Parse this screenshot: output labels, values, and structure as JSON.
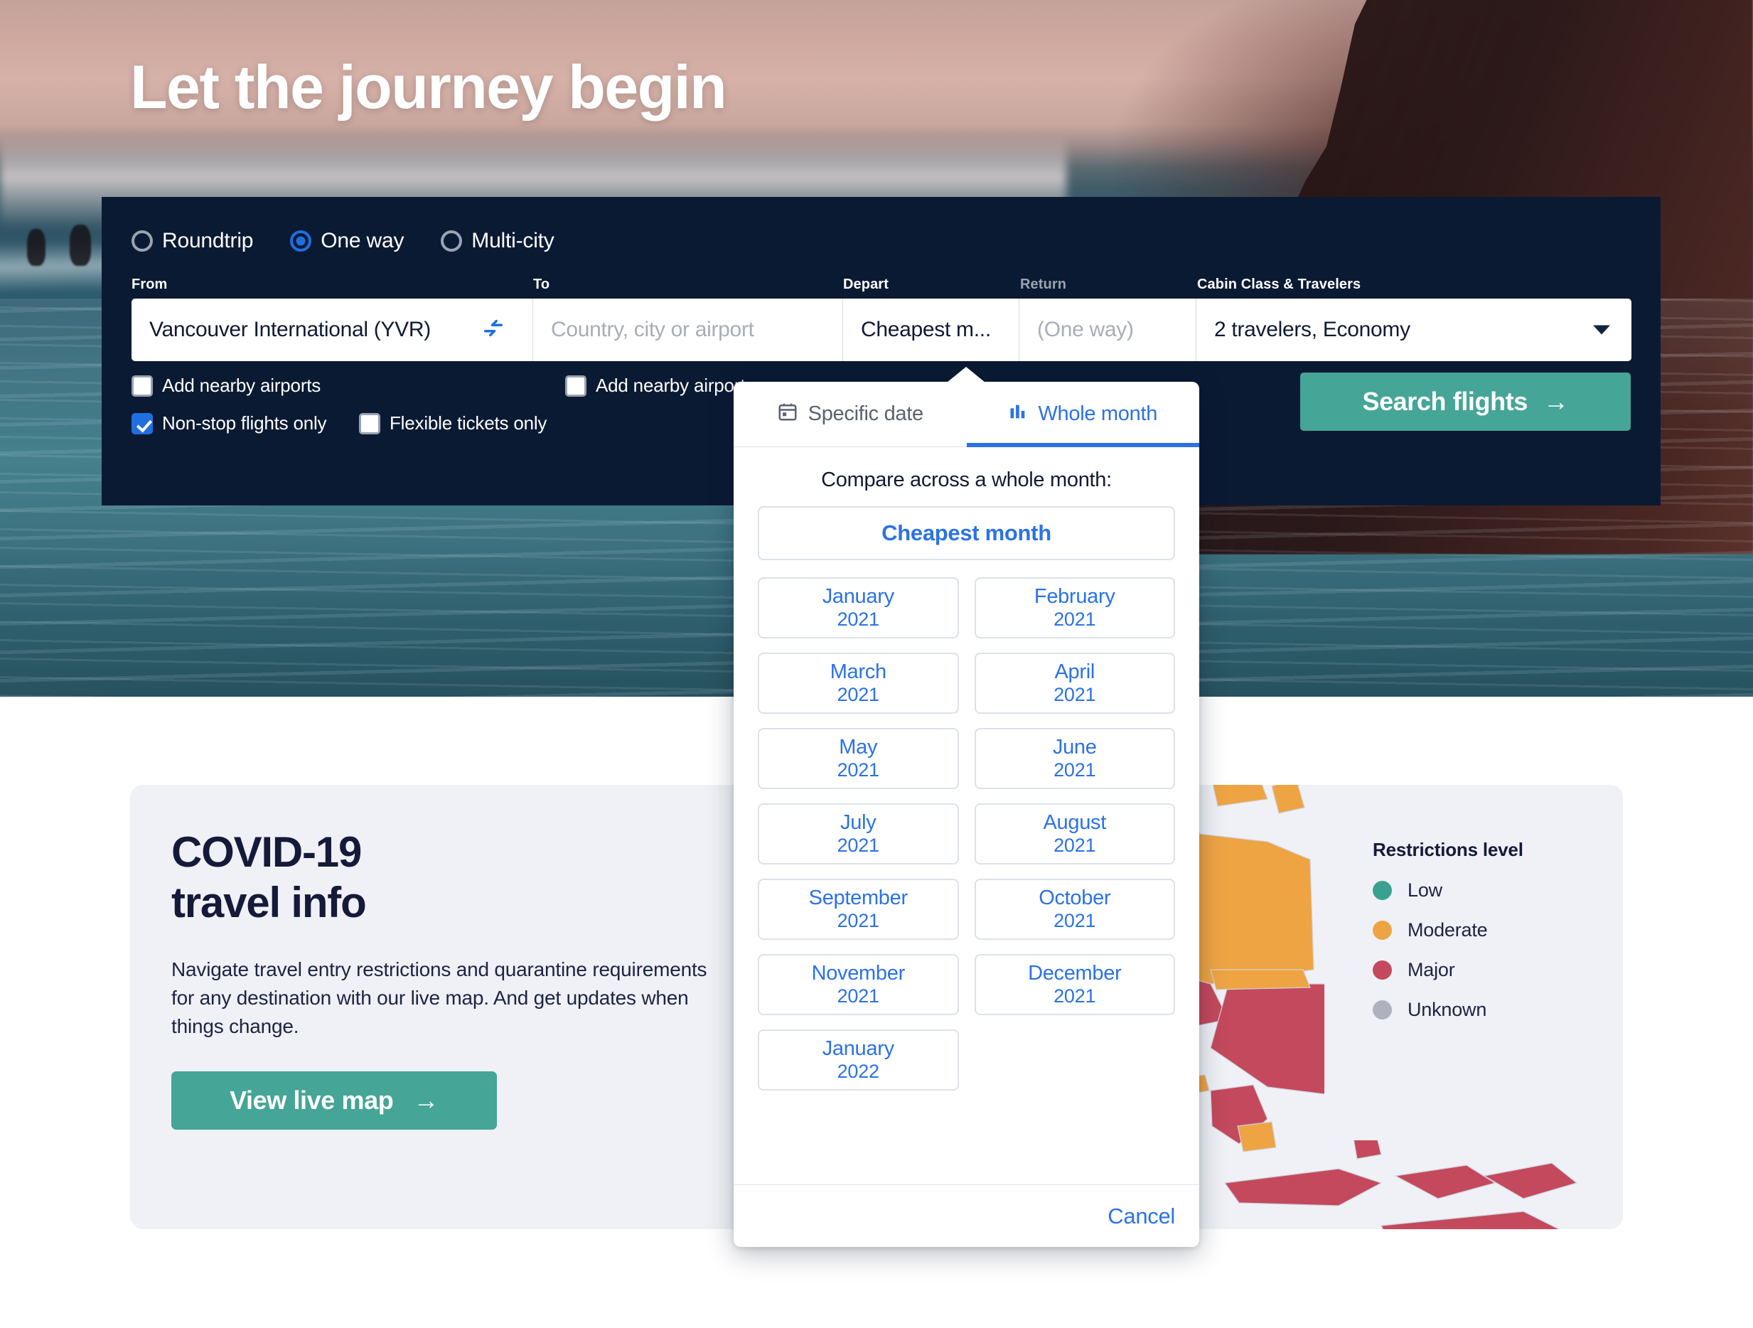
{
  "hero": {
    "title": "Let the journey begin"
  },
  "search": {
    "trip_types": [
      {
        "label": "Roundtrip",
        "selected": false
      },
      {
        "label": "One way",
        "selected": true
      },
      {
        "label": "Multi-city",
        "selected": false
      }
    ],
    "labels": {
      "from": "From",
      "to": "To",
      "depart": "Depart",
      "return": "Return",
      "cabin": "Cabin Class & Travelers"
    },
    "fields": {
      "from_value": "Vancouver International (YVR)",
      "to_placeholder": "Country, city or airport",
      "depart_value": "Cheapest m...",
      "return_placeholder": "(One way)",
      "cabin_value": "2 travelers, Economy"
    },
    "checkboxes": [
      {
        "label": "Add nearby airports",
        "checked": false
      },
      {
        "label": "Add nearby airports",
        "checked": false
      },
      {
        "label": "Non-stop flights only",
        "checked": true
      },
      {
        "label": "Flexible tickets only",
        "checked": false
      }
    ],
    "search_button": "Search flights",
    "search_button_arrow": "→"
  },
  "date_dropdown": {
    "tabs": [
      {
        "label": "Specific date",
        "icon": "calendar-icon",
        "active": false
      },
      {
        "label": "Whole month",
        "icon": "bar-chart-icon",
        "active": true
      }
    ],
    "heading": "Compare across a whole month:",
    "cheapest_month": "Cheapest month",
    "months": [
      {
        "month": "January",
        "year": "2021"
      },
      {
        "month": "February",
        "year": "2021"
      },
      {
        "month": "March",
        "year": "2021"
      },
      {
        "month": "April",
        "year": "2021"
      },
      {
        "month": "May",
        "year": "2021"
      },
      {
        "month": "June",
        "year": "2021"
      },
      {
        "month": "July",
        "year": "2021"
      },
      {
        "month": "August",
        "year": "2021"
      },
      {
        "month": "September",
        "year": "2021"
      },
      {
        "month": "October",
        "year": "2021"
      },
      {
        "month": "November",
        "year": "2021"
      },
      {
        "month": "December",
        "year": "2021"
      },
      {
        "month": "January",
        "year": "2022"
      }
    ],
    "cancel": "Cancel"
  },
  "covid": {
    "title_line1": "COVID-19",
    "title_line2": "travel info",
    "paragraph": "Navigate travel entry restrictions and quarantine requirements for any destination with our live map. And get updates when things change.",
    "button": "View live map",
    "button_arrow": "→",
    "legend_title": "Restrictions level",
    "legend": [
      {
        "label": "Low",
        "color": "#3aa191"
      },
      {
        "label": "Moderate",
        "color": "#eea443"
      },
      {
        "label": "Major",
        "color": "#c4495c"
      },
      {
        "label": "Unknown",
        "color": "#afb2bd"
      }
    ]
  },
  "colors": {
    "panel_bg": "#0b1a33",
    "accent_blue": "#2b72e6",
    "accent_teal": "#45a596",
    "card_bg": "#eff1f6",
    "ink": "#151a3a"
  }
}
